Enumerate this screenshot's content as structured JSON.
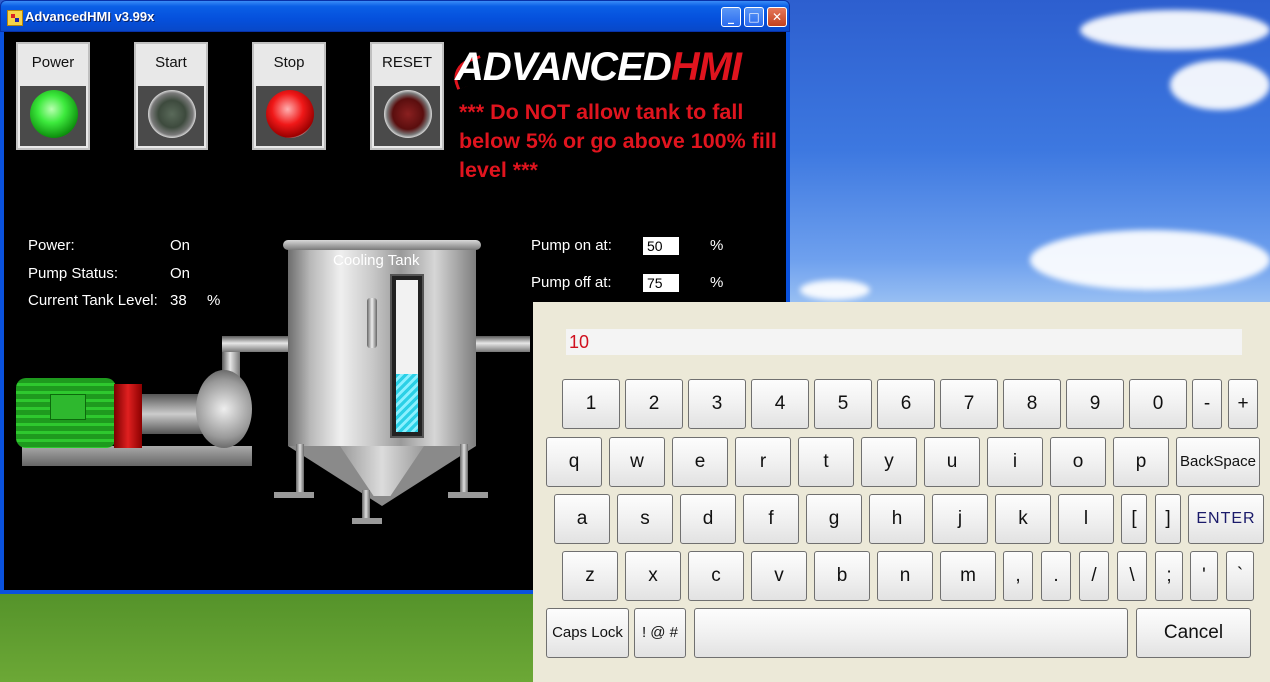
{
  "window": {
    "title": "AdvancedHMI v3.99x",
    "controls": {
      "minimize": "_",
      "maximize": "□",
      "close": "✕"
    }
  },
  "buttons": {
    "power": "Power",
    "start": "Start",
    "stop": "Stop",
    "reset": "RESET"
  },
  "logo": {
    "advanced": "ADVANCED",
    "hmi": "HMI"
  },
  "warning": "*** Do NOT allow tank to fall below 5% or go above 100% fill level ***",
  "status": {
    "power_label": "Power:",
    "power_value": "On",
    "pump_label": "Pump Status:",
    "pump_value": "On",
    "level_label": "Current Tank Level:",
    "level_value": "38",
    "level_unit": "%"
  },
  "setpoints": {
    "pump_on_label": "Pump on at:",
    "pump_on_value": "50",
    "pump_on_unit": "%",
    "pump_off_label": "Pump off at:",
    "pump_off_value": "75",
    "pump_off_unit": "%"
  },
  "tank": {
    "title": "Cooling Tank",
    "fill_fraction": 0.38
  },
  "keypad": {
    "input_value": "10",
    "row1": [
      "1",
      "2",
      "3",
      "4",
      "5",
      "6",
      "7",
      "8",
      "9",
      "0",
      "-",
      "+"
    ],
    "row2": [
      "q",
      "w",
      "e",
      "r",
      "t",
      "y",
      "u",
      "i",
      "o",
      "p",
      "BackSpace"
    ],
    "row3": [
      "a",
      "s",
      "d",
      "f",
      "g",
      "h",
      "j",
      "k",
      "l",
      "[",
      "]",
      "ENTER"
    ],
    "row4": [
      "z",
      "x",
      "c",
      "v",
      "b",
      "n",
      "m",
      ",",
      ".",
      "/",
      "\\",
      ";",
      "'",
      "`"
    ],
    "caps_lock": "Caps Lock",
    "symbols": "! @ #",
    "space": "",
    "cancel": "Cancel"
  }
}
